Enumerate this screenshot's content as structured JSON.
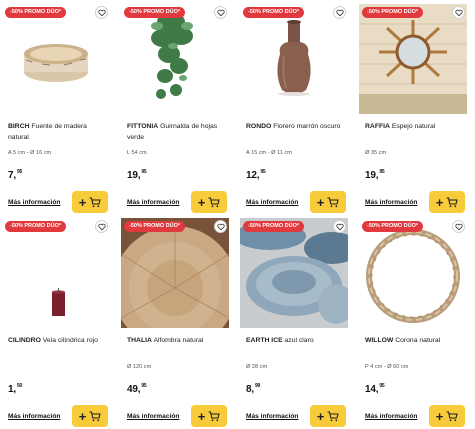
{
  "colors": {
    "badge": "#e03a3e",
    "cart_button": "#f7cb3a",
    "text": "#222222"
  },
  "icons": {
    "favorite": "heart-icon",
    "add": "plus-icon",
    "cart": "cart-icon"
  },
  "products": [
    {
      "badge": "-50% PROMO DÚO*",
      "brand": "BIRCH",
      "title": "Fuente de madera natural",
      "dims": "A 5 cm - Ø 16 cm",
      "price_int": "7,",
      "price_dec": "95",
      "more": "Más información"
    },
    {
      "badge": "-50% PROMO DÚO*",
      "brand": "FITTONIA",
      "title": "Guirnalda de hojas verde",
      "dims": "L 54 cm",
      "price_int": "19,",
      "price_dec": "95",
      "more": "Más información"
    },
    {
      "badge": "-50% PROMO DÚO*",
      "brand": "RONDO",
      "title": "Florero marrón oscuro",
      "dims": "A 15 cm - Ø 11 cm",
      "price_int": "12,",
      "price_dec": "95",
      "more": "Más información"
    },
    {
      "badge": "-50% PROMO DÚO*",
      "brand": "RAFFIA",
      "title": "Espejo natural",
      "dims": "Ø 35 cm",
      "price_int": "19,",
      "price_dec": "95",
      "more": "Más información"
    },
    {
      "badge": "-50% PROMO DÚO*",
      "brand": "CILINDRO",
      "title": "Vela cilíndrica rojo",
      "dims": "",
      "price_int": "1,",
      "price_dec": "50",
      "more": "Más información"
    },
    {
      "badge": "-50% PROMO DÚO*",
      "brand": "THALIA",
      "title": "Alfombra natural",
      "dims": "Ø 120 cm",
      "price_int": "49,",
      "price_dec": "95",
      "more": "Más información"
    },
    {
      "badge": "-50% PROMO DÚO*",
      "brand": "EARTH ICE",
      "title": "azul claro",
      "dims": "Ø 28 cm",
      "price_int": "8,",
      "price_dec": "99",
      "more": "Más información"
    },
    {
      "badge": "-50% PROMO DÚO*",
      "brand": "WILLOW",
      "title": "Corona natural",
      "dims": "P 4 cm - Ø 60 cm",
      "price_int": "14,",
      "price_dec": "95",
      "more": "Más información"
    }
  ]
}
